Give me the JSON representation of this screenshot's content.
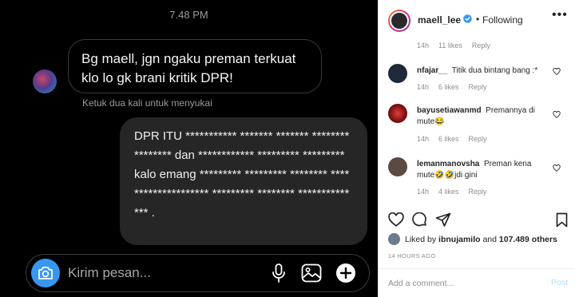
{
  "chat": {
    "time": "7.48 PM",
    "incoming_message": "Bg maell, jgn ngaku preman terkuat klo lo gk brani kritik DPR!",
    "like_hint": "Ketuk dua kali untuk menyukai",
    "outgoing_message": "DPR ITU *********** ******* ******* **************** dan ************ ********* ********* kalo emang ********* ********* ******** **** **************** ********* ******** ************** .",
    "composer_placeholder": "Kirim pesan..."
  },
  "panel": {
    "header": {
      "username": "maell_lee",
      "separator": "•",
      "follow_label": "Following",
      "more": "•••"
    },
    "top_meta": {
      "time": "14h",
      "likes": "11 likes",
      "reply": "Reply"
    },
    "comments": [
      {
        "user": "nfajar__",
        "text": "Titik dua bintang bang :*",
        "time": "14h",
        "likes": "6 likes",
        "reply": "Reply"
      },
      {
        "user": "bayusetiawanmd",
        "text": "Premannya di mute😂",
        "time": "14h",
        "likes": "6 likes",
        "reply": "Reply"
      },
      {
        "user": "lemanmanovsha",
        "text": "Preman kena mute🤣🤣jdi gini",
        "time": "14h",
        "likes": "4 likes",
        "reply": "Reply"
      }
    ],
    "likes": {
      "prefix": "Liked by",
      "user": "ibnujamilo",
      "conj": "and",
      "others": "107.489 others"
    },
    "date": "14 HOURS AGO",
    "comment_placeholder": "Add a comment...",
    "post_label": "Post"
  },
  "colors": {
    "accent_blue": "#3797f0",
    "verified_blue": "#3897f0",
    "chat_bg": "#000000",
    "bubble_out": "#262626"
  },
  "icons": [
    "camera-icon",
    "mic-icon",
    "gallery-icon",
    "plus-icon",
    "verified-icon",
    "heart-icon",
    "comment-icon",
    "share-icon",
    "bookmark-icon"
  ]
}
